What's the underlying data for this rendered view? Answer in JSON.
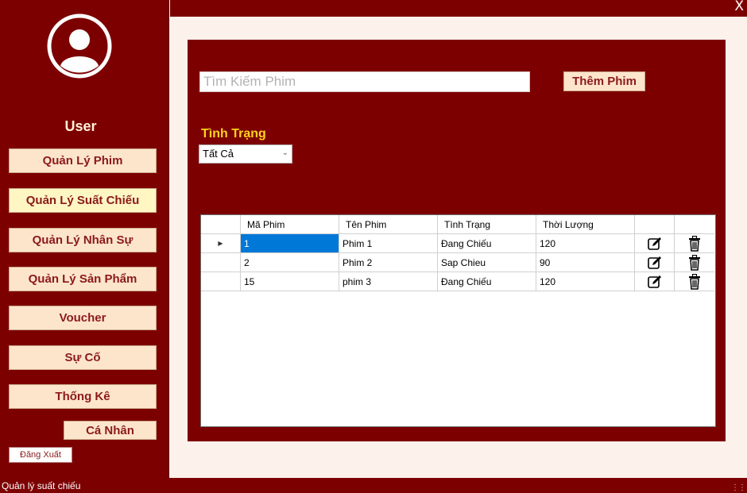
{
  "window": {
    "close_label": "X"
  },
  "sidebar": {
    "user_label": "User",
    "items": [
      {
        "label": "Quản Lý Phim"
      },
      {
        "label": "Quản Lý Suất Chiếu"
      },
      {
        "label": "Quản Lý Nhân Sự"
      },
      {
        "label": "Quản Lý Sản Phẩm"
      },
      {
        "label": "Voucher"
      },
      {
        "label": "Sự Cố"
      },
      {
        "label": "Thống Kê"
      },
      {
        "label": "Cá Nhân"
      }
    ],
    "logout_label": "Đăng Xuất"
  },
  "main": {
    "search": {
      "placeholder": "Tìm Kiếm Phim"
    },
    "add_button": "Thêm Phim",
    "filter": {
      "label": "Tình Trạng",
      "value": "Tất Cả"
    },
    "table": {
      "columns": [
        "Mã Phim",
        "Tên Phim",
        "Tình Trạng",
        "Thời Lượng"
      ],
      "rows": [
        {
          "id": "1",
          "name": "Phim 1",
          "status": "Đang Chiếu",
          "duration": "120"
        },
        {
          "id": "2",
          "name": "Phim 2",
          "status": "Sap Chieu",
          "duration": "90"
        },
        {
          "id": "15",
          "name": "phim 3",
          "status": "Đang Chiếu",
          "duration": "120"
        }
      ]
    }
  },
  "statusbar": {
    "text": "Quản lý suất chiếu"
  },
  "colors": {
    "primary": "#7d0000",
    "button_bg": "#fde5cc",
    "button_text": "#8b1a1a",
    "label_yellow": "#ffd21e",
    "selection": "#0078d7"
  },
  "icons": {
    "avatar": "user-circle-icon",
    "edit": "edit-icon",
    "delete": "trash-icon"
  }
}
